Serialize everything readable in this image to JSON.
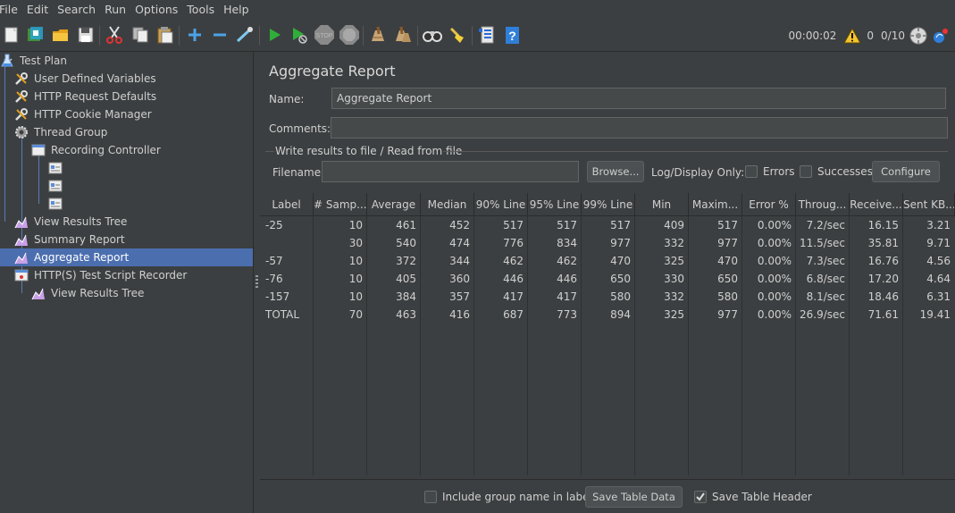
{
  "menu": [
    "File",
    "Edit",
    "Search",
    "Run",
    "Options",
    "Tools",
    "Help"
  ],
  "toolbar": {
    "icons": [
      "new-icon",
      "templates-icon",
      "open-icon",
      "save-icon",
      "cut-icon",
      "copy-icon",
      "paste-icon",
      "expand-icon",
      "collapse-icon",
      "toggle-icon",
      "start-icon",
      "start-no-pauses-icon",
      "stop-icon",
      "shutdown-icon",
      "clear-icon",
      "clear-all-icon",
      "search-icon",
      "reset-search-icon",
      "function-helper-icon",
      "help-icon"
    ],
    "timer": "00:00:02",
    "warnings": "0",
    "threads": "0/10"
  },
  "tree": [
    {
      "label": "Test Plan",
      "icon": "flask-icon"
    },
    {
      "label": "User Defined Variables",
      "icon": "wrench-icon"
    },
    {
      "label": "HTTP Request Defaults",
      "icon": "wrench-icon"
    },
    {
      "label": "HTTP Cookie Manager",
      "icon": "wrench-icon"
    },
    {
      "label": "Thread Group",
      "icon": "gear-icon"
    },
    {
      "label": "Recording Controller",
      "icon": "controller-icon"
    },
    {
      "label": "",
      "icon": "sampler-icon"
    },
    {
      "label": "",
      "icon": "sampler-icon"
    },
    {
      "label": "",
      "icon": "sampler-icon"
    },
    {
      "label": "View Results Tree",
      "icon": "listener-icon"
    },
    {
      "label": "Summary Report",
      "icon": "listener-icon"
    },
    {
      "label": "Aggregate Report",
      "icon": "listener-icon"
    },
    {
      "label": "HTTP(S) Test Script Recorder",
      "icon": "recorder-icon"
    },
    {
      "label": "View Results Tree",
      "icon": "listener-icon"
    }
  ],
  "panel": {
    "title": "Aggregate Report",
    "name_label": "Name:",
    "name_value": "Aggregate Report",
    "comments_label": "Comments:",
    "comments_value": "",
    "group_title": "Write results to file / Read from file",
    "filename_label": "Filename",
    "filename_value": "",
    "browse_label": "Browse...",
    "log_display_label": "Log/Display Only:",
    "errors_label": "Errors",
    "successes_label": "Successes",
    "configure_label": "Configure"
  },
  "table": {
    "headers": [
      "Label",
      "# Samp...",
      "Average",
      "Median",
      "90% Line",
      "95% Line",
      "99% Line",
      "Min",
      "Maxim...",
      "Error %",
      "Throug...",
      "Receive...",
      "Sent KB..."
    ],
    "rows": [
      [
        "-25",
        "10",
        "461",
        "452",
        "517",
        "517",
        "517",
        "409",
        "517",
        "0.00%",
        "7.2/sec",
        "16.15",
        "3.21"
      ],
      [
        "",
        "30",
        "540",
        "474",
        "776",
        "834",
        "977",
        "332",
        "977",
        "0.00%",
        "11.5/sec",
        "35.81",
        "9.71"
      ],
      [
        "-57",
        "10",
        "372",
        "344",
        "462",
        "462",
        "470",
        "325",
        "470",
        "0.00%",
        "7.3/sec",
        "16.76",
        "4.56"
      ],
      [
        "-76",
        "10",
        "405",
        "360",
        "446",
        "446",
        "650",
        "330",
        "650",
        "0.00%",
        "6.8/sec",
        "17.20",
        "4.64"
      ],
      [
        "-157",
        "10",
        "384",
        "357",
        "417",
        "417",
        "580",
        "332",
        "580",
        "0.00%",
        "8.1/sec",
        "18.46",
        "6.31"
      ],
      [
        "TOTAL",
        "70",
        "463",
        "416",
        "687",
        "773",
        "894",
        "325",
        "977",
        "0.00%",
        "26.9/sec",
        "71.61",
        "19.41"
      ]
    ]
  },
  "bottom": {
    "include_group_label": "Include group name in label?",
    "include_group_checked": false,
    "save_table_data_label": "Save Table Data",
    "save_table_header_label": "Save Table Header",
    "save_table_header_checked": true
  }
}
